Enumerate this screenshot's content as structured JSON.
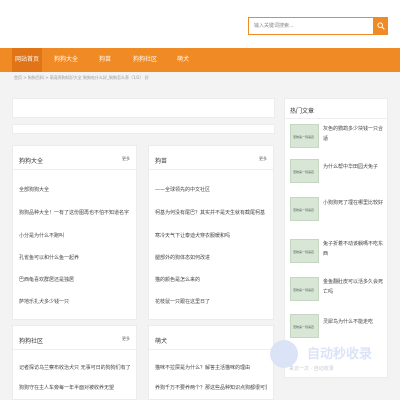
{
  "search": {
    "placeholder": "输入关键词搜索..."
  },
  "nav": [
    {
      "label": "网站首页"
    },
    {
      "label": "狗狗大全"
    },
    {
      "label": "狗苗"
    },
    {
      "label": "狗狗社区"
    },
    {
      "label": "萌犬"
    }
  ],
  "breadcrumb": "首页 > 狗狗百科 > 萌宠养狗知识大全 狗狗吃什么好_狗狗怎么养（1/2） 好",
  "blocks": [
    {
      "title": "狗狗大全",
      "more": "更多",
      "items": [
        "全部狗狗大全",
        "狗狗品种大全！一有了这份图再也不怕不知道名字",
        "小分是为什么不跑叫",
        "孔雀鱼可以和什么鱼一起养",
        "巴西龟喜欢群居还是独居",
        "萨地乐扎犬多少钱一只"
      ]
    },
    {
      "title": "狗苗",
      "more": "更多",
      "items": [
        "——全球领先的中文社区",
        "柯基为何没有尾巴？其实并不是天生就有截尾柯基",
        "寒冷天气下让泰迪犬穿衣服暖和吗",
        "腿部外的狗体态如何改进",
        "猫的颜色是怎么来的",
        "花枝鼠一只跟在这里日了"
      ]
    },
    {
      "title": "狗狗社区",
      "more": "更多",
      "items": [
        "记者探访乌兰察布收治犬只 无事可日的狗狗们有了家",
        "狗狗守在主人车旁每一年半面对被收养无望"
      ]
    },
    {
      "title": "萌犬",
      "more": "",
      "items": [
        "猫咪不拉屎是为什么？解答主活猫咪的理由",
        "养狗千万不要养两个？那这些品种知识点狗都很可爱"
      ]
    }
  ],
  "sidebar": {
    "title": "热门文章",
    "thumb_label": "宠物第一到第四",
    "items": [
      "灰色的鹦鹉多少块钱一只合适",
      "为什么帮中华田园犬免子",
      "小狗狗死了埋在哪里比较好",
      "兔子折着不动该躺嗎不吃东西",
      "金鱼翻肚皮可以活多久会死亡吗",
      "灵犀鸟为什么不能走吃"
    ]
  },
  "watermark": {
    "main": "自动秒收录",
    "sub": "来访一次 · 自动收录"
  }
}
